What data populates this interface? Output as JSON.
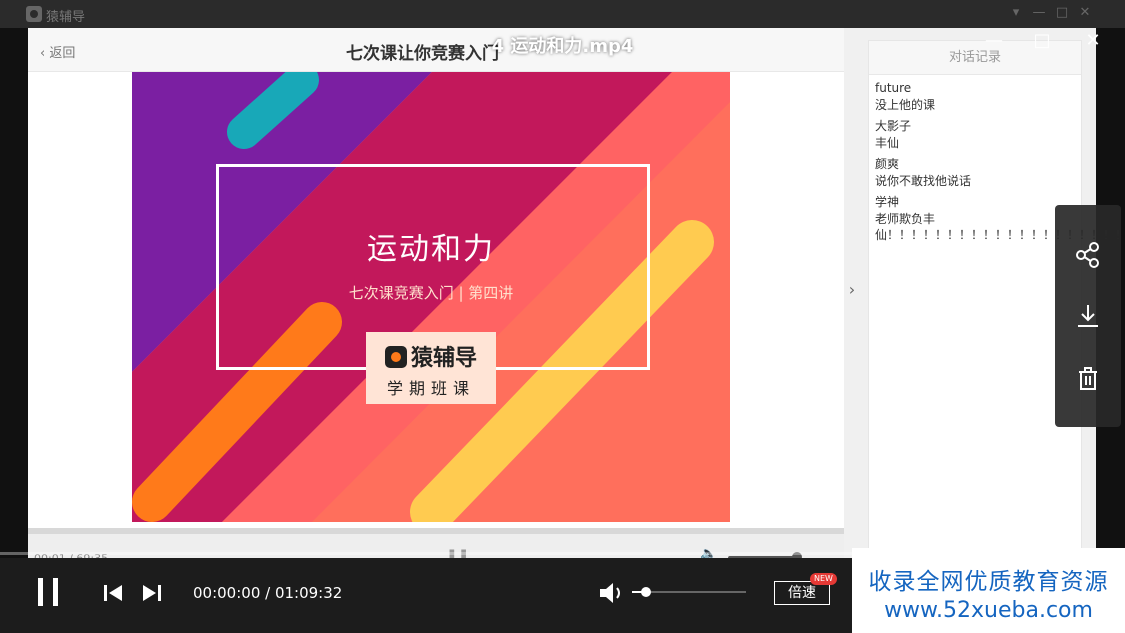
{
  "window": {
    "app_name": "猿辅导",
    "controls": [
      "menu-icon",
      "minimize-icon",
      "maximize-icon",
      "close-icon"
    ]
  },
  "overlay": {
    "file_title": "4 运动和力.mp4"
  },
  "inner_player": {
    "back_label": "返回",
    "lesson_title": "七次课让你竞赛入门",
    "time": "00:01 / 69:35",
    "volume_level": 0.9
  },
  "slide": {
    "title": "运动和力",
    "subtitle": "七次课竞赛入门 | 第四讲",
    "brand_name": "猿辅导",
    "brand_tag": "学期班课"
  },
  "chat": {
    "title": "对话记录",
    "messages": [
      {
        "user": "future",
        "text": "没上他的课"
      },
      {
        "user": "大影子",
        "text": "丰仙"
      },
      {
        "user": "颜爽",
        "text": "说你不敢找他说话"
      },
      {
        "user": "学神",
        "text": "老师欺负丰仙！！！！！！！！！！！！！！！！！！！！！！！！！"
      }
    ]
  },
  "share_panel": {
    "buttons": [
      "share-icon",
      "download-icon",
      "delete-icon"
    ]
  },
  "controls": {
    "time_readout": "00:00:00 / 01:09:32",
    "speed_label": "倍速",
    "new_badge": "NEW",
    "volume_level": 0.12,
    "progress": 0
  },
  "watermark": {
    "line1": "收录全网优质教育资源",
    "line2": "www.52xueba.com"
  },
  "colors": {
    "watermark_blue": "#1565c0",
    "slide_coral": "#ff6f5c",
    "slide_purple": "#6a1b9a",
    "accent_orange": "#ff7a1a",
    "badge_red": "#e53935"
  }
}
